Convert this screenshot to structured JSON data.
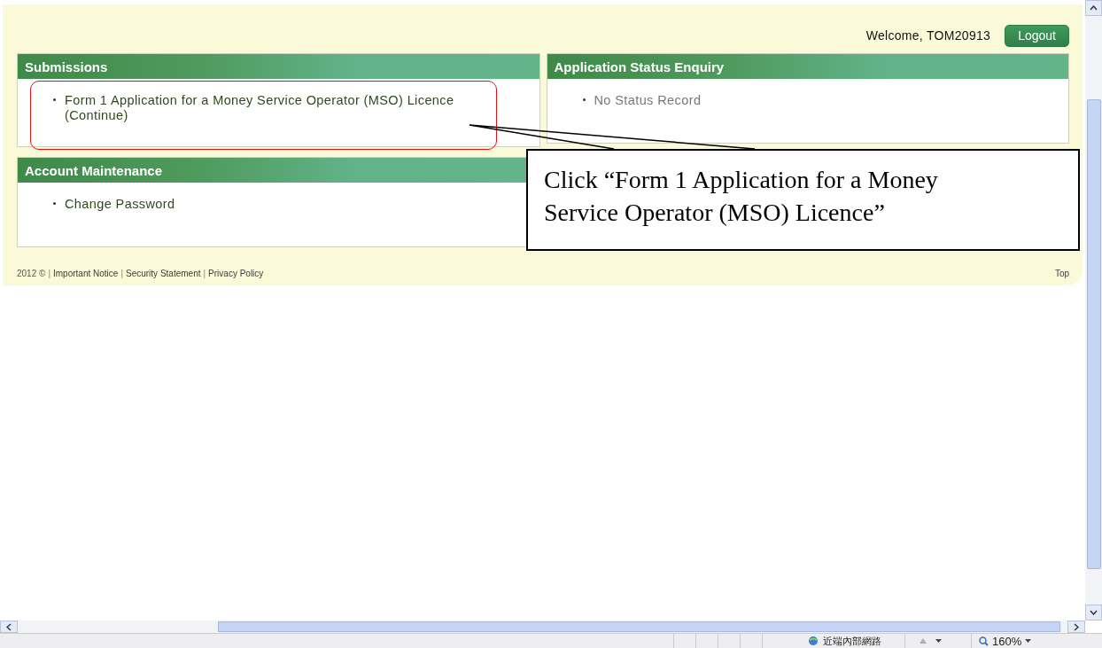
{
  "header": {
    "welcome": "Welcome, TOM20913",
    "logout": "Logout"
  },
  "left_panels": [
    {
      "title": "Submissions",
      "items": [
        {
          "text": "Form 1 Application for a Money Service Operator (MSO) Licence (Continue)",
          "kind": "link"
        }
      ]
    },
    {
      "title": "Account Maintenance",
      "items": [
        {
          "text": "Change Password",
          "kind": "link"
        }
      ]
    }
  ],
  "right_panels": [
    {
      "title": "Application Status Enquiry",
      "items": [
        {
          "text": "No Status Record",
          "kind": "note"
        }
      ]
    }
  ],
  "footer": {
    "items": [
      {
        "text": "2012 ©",
        "kind": "text"
      },
      {
        "text": "|",
        "kind": "separator"
      },
      {
        "text": "Important Notice",
        "kind": "link"
      },
      {
        "text": "|",
        "kind": "separator"
      },
      {
        "text": "Security Statement",
        "kind": "link"
      },
      {
        "text": "|",
        "kind": "separator"
      },
      {
        "text": "Privacy Policy",
        "kind": "link"
      }
    ],
    "top": "Top"
  },
  "callout": {
    "text": "Click “Form 1 Application for a Money Service Operator (MSO) Licence”"
  },
  "status_bar": {
    "zone": "近端內部網路",
    "zoom": "160%"
  }
}
